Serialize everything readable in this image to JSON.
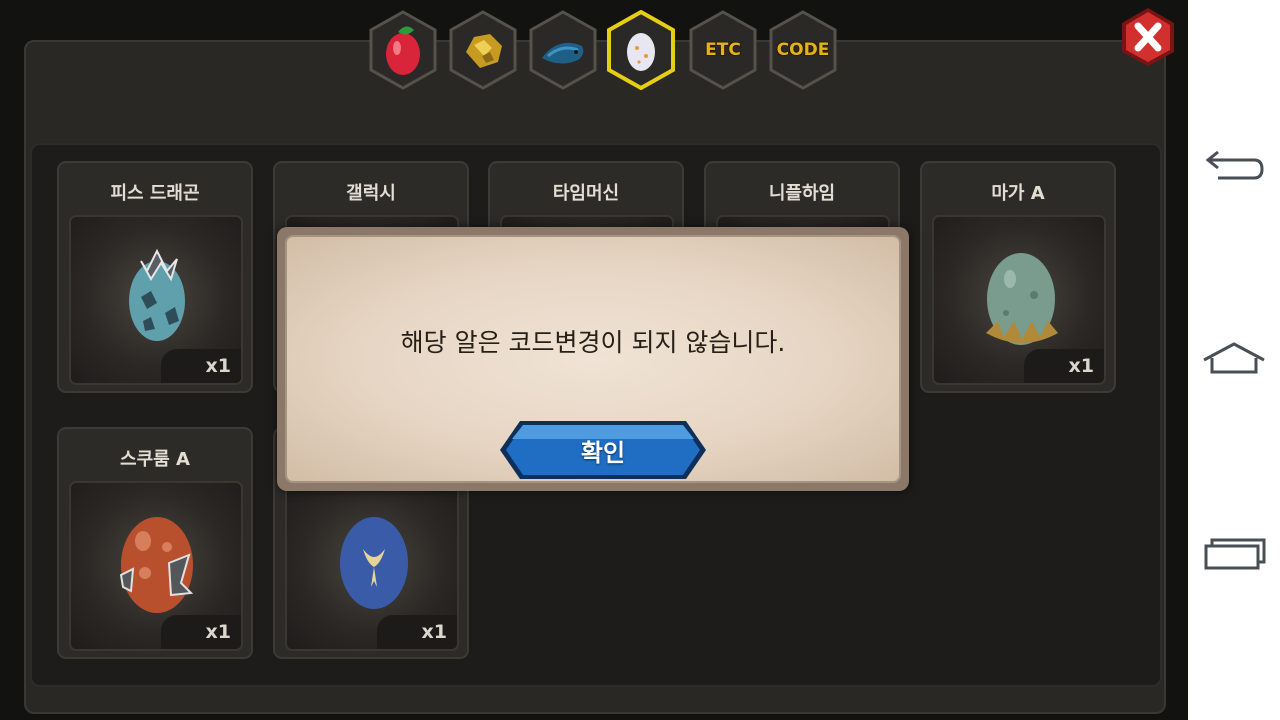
{
  "tabs": [
    {
      "label": "",
      "icon": "fruit-icon",
      "selected": false
    },
    {
      "label": "",
      "icon": "ore-icon",
      "selected": false
    },
    {
      "label": "",
      "icon": "fish-icon",
      "selected": false
    },
    {
      "label": "",
      "icon": "egg-icon",
      "selected": true
    },
    {
      "label": "ETC",
      "icon": "",
      "selected": false
    },
    {
      "label": "CODE",
      "icon": "",
      "selected": false
    }
  ],
  "items": [
    {
      "name": "피스 드래곤",
      "quantity": "x1",
      "icon": "peace-dragon-egg-icon"
    },
    {
      "name": "갤럭시",
      "quantity": "",
      "icon": "galaxy-egg-icon"
    },
    {
      "name": "타임머신",
      "quantity": "",
      "icon": "time-machine-egg-icon"
    },
    {
      "name": "니플하임",
      "quantity": "",
      "icon": "niflheim-egg-icon"
    },
    {
      "name": "마가 A",
      "quantity": "x1",
      "icon": "maga-egg-icon"
    },
    {
      "name": "스쿠룸 A",
      "quantity": "x1",
      "icon": "skurum-egg-icon"
    },
    {
      "name": "",
      "quantity": "x1",
      "icon": "blue-egg-icon"
    }
  ],
  "dialog": {
    "message": "해당 알은 코드변경이 되지 않습니다.",
    "confirm_label": "확인"
  },
  "colors": {
    "tab_selected_border": "#e6cf12",
    "tab_text": "#e2b21b",
    "close_button": "#c62a2a",
    "confirm_button": "#1f6ec4",
    "dialog_bg": "#e9dccd"
  },
  "navbar": {
    "icons": [
      "back-icon",
      "home-icon",
      "recent-apps-icon"
    ]
  }
}
